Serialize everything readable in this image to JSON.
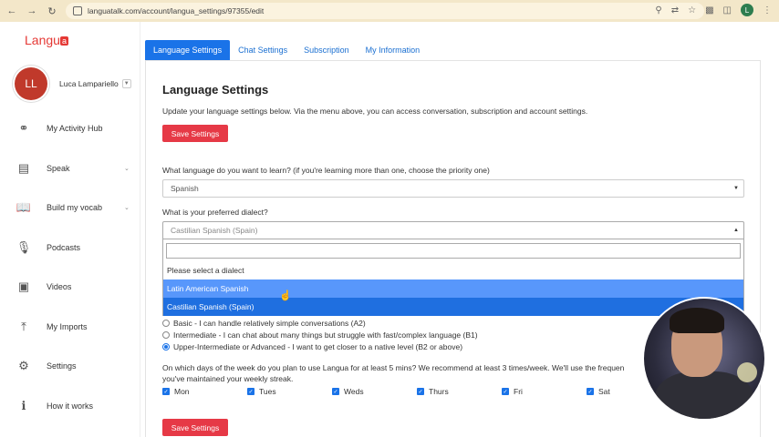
{
  "browser": {
    "url": "languatalk.com/account/langua_settings/97355/edit",
    "profile_initial": "L"
  },
  "sidebar": {
    "logo": "Langu",
    "logo_badge": "a",
    "user_initials": "LL",
    "user_name": "Luca Lampariello",
    "items": [
      {
        "label": "My Activity Hub",
        "icon": "activity-icon"
      },
      {
        "label": "Speak",
        "icon": "chat-icon",
        "has_caret": true
      },
      {
        "label": "Build my vocab",
        "icon": "book-icon",
        "has_caret": true
      },
      {
        "label": "Podcasts",
        "icon": "microphone-icon"
      },
      {
        "label": "Videos",
        "icon": "video-icon"
      },
      {
        "label": "My Imports",
        "icon": "upload-icon"
      },
      {
        "label": "Settings",
        "icon": "gear-icon"
      },
      {
        "label": "How it works",
        "icon": "info-icon"
      }
    ]
  },
  "tabs": [
    "Language Settings",
    "Chat Settings",
    "Subscription",
    "My Information"
  ],
  "main": {
    "title": "Language Settings",
    "intro": "Update your language settings below. Via the menu above, you can access conversation, subscription and account settings.",
    "save_label": "Save Settings",
    "q_language": "What language do you want to learn? (if you're learning more than one, choose the priority one)",
    "language_value": "Spanish",
    "q_dialect": "What is your preferred dialect?",
    "dialect_value": "Castilian Spanish (Spain)",
    "dropdown_options": [
      "Please select a dialect",
      "Latin American Spanish",
      "Castilian Spanish (Spain)"
    ],
    "levels": [
      "Basic - I can handle relatively simple conversations (A2)",
      "Intermediate - I can chat about many things but struggle with fast/complex language (B1)",
      "Upper-Intermediate or Advanced - I want to get closer to a native level (B2 or above)"
    ],
    "selected_level_index": 2,
    "days_question": "On which days of the week do you plan to use Langua for at least 5 mins? We recommend at least 3 times/week. We'll use the frequen",
    "days_question_2": "you've maintained your weekly streak.",
    "days": [
      "Mon",
      "Tues",
      "Weds",
      "Thurs",
      "Fri",
      "Sat"
    ]
  },
  "colors": {
    "accent_blue": "#1a73e8",
    "save_red": "#e63946",
    "brand_red": "#e53935"
  }
}
